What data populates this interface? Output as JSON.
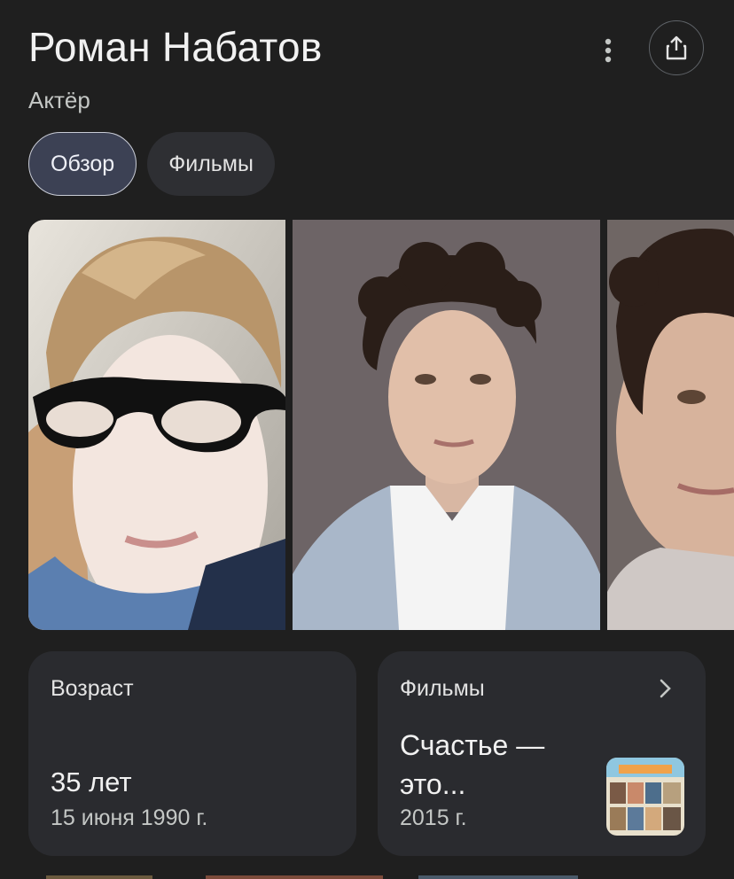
{
  "header": {
    "title": "Роман Набатов",
    "subtitle": "Актёр",
    "more_icon": "more-vert-icon",
    "share_icon": "share-icon"
  },
  "tabs": [
    {
      "label": "Обзор",
      "active": true
    },
    {
      "label": "Фильмы",
      "active": false
    }
  ],
  "cards": {
    "age": {
      "label": "Возраст",
      "value": "35 лет",
      "date": "15 июня 1990 г."
    },
    "films": {
      "label": "Фильмы",
      "title": "Счастье — это...",
      "year": "2015 г.",
      "chevron_icon": "chevron-right-icon"
    }
  },
  "colors": {
    "background": "#1f1f1f",
    "card": "#2a2b2f",
    "tab_active": "#3c4154",
    "tab": "#2e2f33"
  }
}
